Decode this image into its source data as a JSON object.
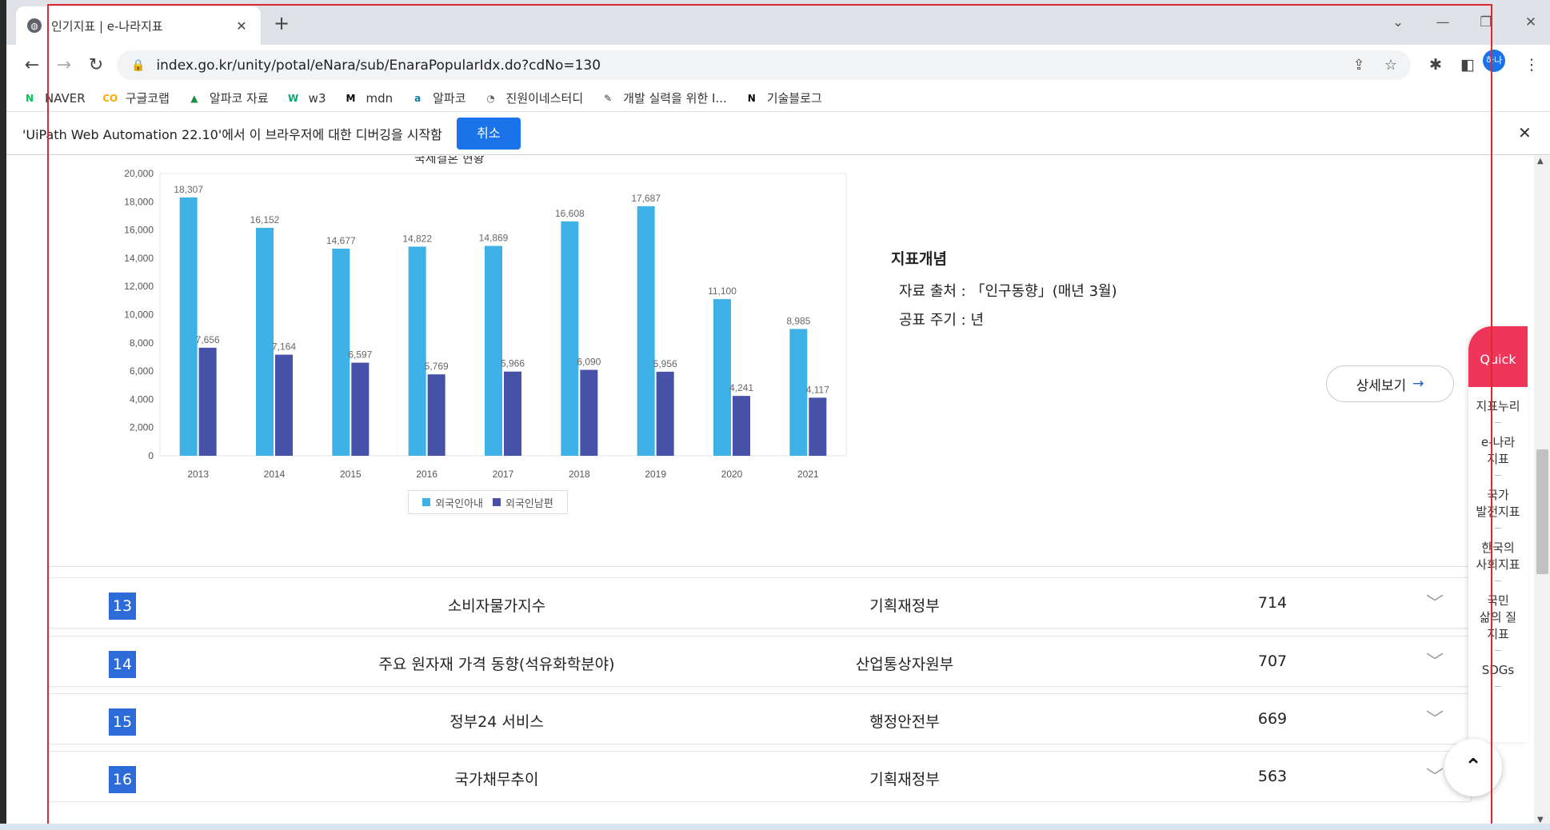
{
  "browser": {
    "tab_title": "인기지표 | e-나라지표",
    "tab_close": "✕",
    "new_tab": "+",
    "url": "index.go.kr/unity/potal/eNara/sub/EnaraPopularIdx.do?cdNo=130",
    "profile_initials": "하나"
  },
  "bookmarks": [
    {
      "label": "NAVER",
      "icon": "N",
      "color": "#03c75a"
    },
    {
      "label": "구글코랩",
      "icon": "CO",
      "color": "#f9ab00"
    },
    {
      "label": "알파코 자료",
      "icon": "▲",
      "color": "#1e8e3e"
    },
    {
      "label": "w3",
      "icon": "W",
      "color": "#04aa6d"
    },
    {
      "label": "mdn",
      "icon": "M",
      "color": "#000000"
    },
    {
      "label": "알파코",
      "icon": "a",
      "color": "#0a7ea4"
    },
    {
      "label": "진원이네스터디",
      "icon": "◔",
      "color": "#5f6368"
    },
    {
      "label": "개발 실력을 위한 I...",
      "icon": "✎",
      "color": "#333333"
    },
    {
      "label": "기술블로그",
      "icon": "N",
      "color": "#000000"
    }
  ],
  "infobar": {
    "text": "'UiPath Web Automation 22.10'에서 이 브라우저에 대한 디버깅을 시작함",
    "cancel_label": "취소",
    "close": "✕"
  },
  "chart_data": {
    "type": "bar",
    "title": "국제결혼 현황",
    "categories": [
      "2013",
      "2014",
      "2015",
      "2016",
      "2017",
      "2018",
      "2019",
      "2020",
      "2021"
    ],
    "series": [
      {
        "name": "외국인아내",
        "color": "#3eb1e6",
        "values": [
          18307,
          16152,
          14677,
          14822,
          14869,
          16608,
          17687,
          11100,
          8985
        ]
      },
      {
        "name": "외국인남편",
        "color": "#4651a8",
        "values": [
          7656,
          7164,
          6597,
          5769,
          5966,
          6090,
          5956,
          4241,
          4117
        ]
      }
    ],
    "value_labels": {
      "series0": [
        "18,307",
        "16,152",
        "14,677",
        "14,822",
        "14,869",
        "16,608",
        "17,687",
        "11,100",
        "8,985"
      ],
      "series1": [
        "7,656",
        "7,164",
        "6,597",
        "5,769",
        "5,966",
        "6,090",
        "5,956",
        "4,241",
        "4,117"
      ]
    },
    "ylim": [
      0,
      20000
    ],
    "yticks": [
      "0",
      "2,000",
      "4,000",
      "6,000",
      "8,000",
      "10,000",
      "12,000",
      "14,000",
      "16,000",
      "18,000",
      "20,000"
    ],
    "legend_position": "bottom",
    "grid": false
  },
  "concept": {
    "heading": "지표개념",
    "source": "자료 출처 : 「인구동향」(매년 3월)",
    "period": "공표 주기 : 년"
  },
  "detail_button": "상세보기",
  "rows": [
    {
      "rank": "13",
      "name": "소비자물가지수",
      "org": "기획재정부",
      "count": "714"
    },
    {
      "rank": "14",
      "name": "주요 원자재 가격 동향(석유화학분야)",
      "org": "산업통상자원부",
      "count": "707"
    },
    {
      "rank": "15",
      "name": "정부24 서비스",
      "org": "행정안전부",
      "count": "669"
    },
    {
      "rank": "16",
      "name": "국가채무추이",
      "org": "기획재정부",
      "count": "563"
    }
  ],
  "quick_menu": {
    "head": "Quick",
    "items": [
      "지표누리",
      "e-나라\n지표",
      "국가\n발전지표",
      "한국의\n사회지표",
      "국민\n삶의 질\n지표",
      "SDGs"
    ]
  }
}
